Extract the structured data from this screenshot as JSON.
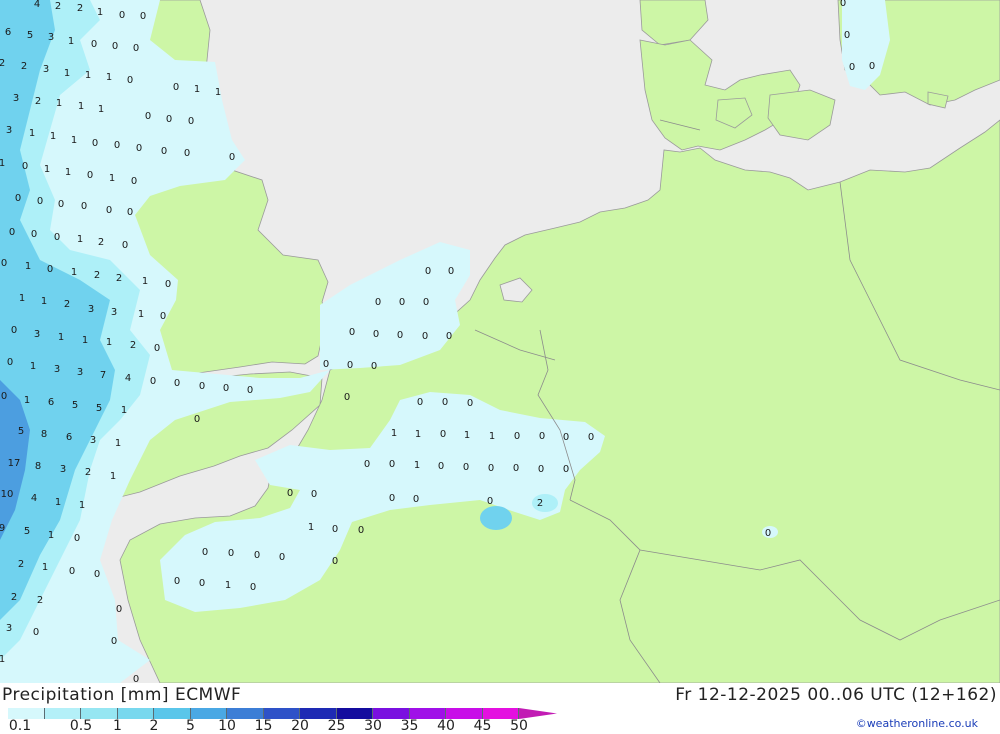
{
  "header": {
    "title": "Precipitation [mm] ECMWF",
    "valid_time": "Fr 12-12-2025 00..06 UTC (12+162)",
    "credit": "©weatheronline.co.uk"
  },
  "legend": {
    "levels": [
      "0.1",
      "0.5",
      "1",
      "2",
      "5",
      "10",
      "15",
      "20",
      "25",
      "30",
      "35",
      "40",
      "45",
      "50"
    ],
    "colors": [
      "#d6f8fc",
      "#b4f0f8",
      "#96e6f2",
      "#78d8ee",
      "#5ac6ea",
      "#4aa8e4",
      "#3c7ed6",
      "#2e52c8",
      "#1e2ab4",
      "#140c9e",
      "#7a10e0",
      "#a010e8",
      "#c80ee8",
      "#e410e0",
      "#c21cb4"
    ]
  },
  "map": {
    "colors": {
      "sea": "#ececec",
      "land": "#cdf6a6",
      "rain_light": "#d6f8fc",
      "rain_mid": "#aef0f8",
      "rain_heavy": "#70d2ee",
      "rain_max": "#4c9ee0",
      "border": "#8c8c8c"
    },
    "values": [
      [
        "4",
        37,
        4
      ],
      [
        "2",
        58,
        6
      ],
      [
        "2",
        80,
        8
      ],
      [
        "1",
        100,
        12
      ],
      [
        "0",
        122,
        15
      ],
      [
        "0",
        143,
        16
      ],
      [
        "6",
        8,
        32
      ],
      [
        "5",
        30,
        35
      ],
      [
        "3",
        51,
        37
      ],
      [
        "1",
        71,
        41
      ],
      [
        "0",
        94,
        44
      ],
      [
        "0",
        115,
        46
      ],
      [
        "0",
        136,
        48
      ],
      [
        "2",
        2,
        63
      ],
      [
        "2",
        24,
        66
      ],
      [
        "3",
        46,
        69
      ],
      [
        "1",
        67,
        73
      ],
      [
        "1",
        88,
        75
      ],
      [
        "1",
        109,
        77
      ],
      [
        "0",
        130,
        80
      ],
      [
        "0",
        176,
        87
      ],
      [
        "1",
        197,
        89
      ],
      [
        "1",
        218,
        92
      ],
      [
        "3",
        16,
        98
      ],
      [
        "2",
        38,
        101
      ],
      [
        "1",
        59,
        103
      ],
      [
        "1",
        81,
        106
      ],
      [
        "1",
        101,
        109
      ],
      [
        "0",
        148,
        116
      ],
      [
        "0",
        169,
        119
      ],
      [
        "0",
        191,
        121
      ],
      [
        "3",
        9,
        130
      ],
      [
        "1",
        32,
        133
      ],
      [
        "1",
        53,
        136
      ],
      [
        "1",
        74,
        140
      ],
      [
        "0",
        95,
        143
      ],
      [
        "0",
        117,
        145
      ],
      [
        "0",
        139,
        148
      ],
      [
        "0",
        164,
        151
      ],
      [
        "0",
        187,
        153
      ],
      [
        "0",
        232,
        157
      ],
      [
        "1",
        2,
        163
      ],
      [
        "0",
        25,
        166
      ],
      [
        "1",
        47,
        169
      ],
      [
        "1",
        68,
        172
      ],
      [
        "0",
        90,
        175
      ],
      [
        "1",
        112,
        178
      ],
      [
        "0",
        134,
        181
      ],
      [
        "0",
        18,
        198
      ],
      [
        "0",
        40,
        201
      ],
      [
        "0",
        61,
        204
      ],
      [
        "0",
        84,
        206
      ],
      [
        "0",
        109,
        210
      ],
      [
        "0",
        130,
        212
      ],
      [
        "0",
        12,
        232
      ],
      [
        "0",
        34,
        234
      ],
      [
        "0",
        57,
        237
      ],
      [
        "1",
        80,
        239
      ],
      [
        "2",
        101,
        242
      ],
      [
        "0",
        125,
        245
      ],
      [
        "0",
        4,
        263
      ],
      [
        "1",
        28,
        266
      ],
      [
        "0",
        50,
        269
      ],
      [
        "1",
        74,
        272
      ],
      [
        "2",
        97,
        275
      ],
      [
        "2",
        119,
        278
      ],
      [
        "1",
        145,
        281
      ],
      [
        "0",
        168,
        284
      ],
      [
        "1",
        22,
        298
      ],
      [
        "1",
        44,
        301
      ],
      [
        "2",
        67,
        304
      ],
      [
        "3",
        91,
        309
      ],
      [
        "3",
        114,
        312
      ],
      [
        "1",
        141,
        314
      ],
      [
        "0",
        163,
        316
      ],
      [
        "0",
        14,
        330
      ],
      [
        "3",
        37,
        334
      ],
      [
        "1",
        61,
        337
      ],
      [
        "1",
        85,
        340
      ],
      [
        "1",
        109,
        342
      ],
      [
        "2",
        133,
        345
      ],
      [
        "0",
        157,
        348
      ],
      [
        "0",
        10,
        362
      ],
      [
        "1",
        33,
        366
      ],
      [
        "3",
        57,
        369
      ],
      [
        "3",
        80,
        372
      ],
      [
        "7",
        103,
        375
      ],
      [
        "4",
        128,
        378
      ],
      [
        "0",
        153,
        381
      ],
      [
        "0",
        177,
        383
      ],
      [
        "0",
        202,
        386
      ],
      [
        "0",
        226,
        388
      ],
      [
        "0",
        250,
        390
      ],
      [
        "0",
        4,
        396
      ],
      [
        "1",
        27,
        400
      ],
      [
        "6",
        51,
        402
      ],
      [
        "5",
        75,
        405
      ],
      [
        "5",
        99,
        408
      ],
      [
        "1",
        124,
        410
      ],
      [
        "5",
        21,
        431
      ],
      [
        "8",
        44,
        434
      ],
      [
        "6",
        69,
        437
      ],
      [
        "3",
        93,
        440
      ],
      [
        "1",
        118,
        443
      ],
      [
        "17",
        14,
        463
      ],
      [
        "8",
        38,
        466
      ],
      [
        "3",
        63,
        469
      ],
      [
        "2",
        88,
        472
      ],
      [
        "1",
        113,
        476
      ],
      [
        "10",
        7,
        494
      ],
      [
        "4",
        34,
        498
      ],
      [
        "1",
        58,
        502
      ],
      [
        "1",
        82,
        505
      ],
      [
        "9",
        2,
        528
      ],
      [
        "5",
        27,
        531
      ],
      [
        "1",
        51,
        535
      ],
      [
        "0",
        77,
        538
      ],
      [
        "2",
        21,
        564
      ],
      [
        "1",
        45,
        567
      ],
      [
        "0",
        72,
        571
      ],
      [
        "0",
        97,
        574
      ],
      [
        "2",
        14,
        597
      ],
      [
        "2",
        40,
        600
      ],
      [
        "0",
        119,
        609
      ],
      [
        "3",
        9,
        628
      ],
      [
        "0",
        36,
        632
      ],
      [
        "0",
        114,
        641
      ],
      [
        "1",
        2,
        659
      ],
      [
        "0",
        136,
        679
      ],
      [
        "0",
        428,
        271
      ],
      [
        "0",
        451,
        271
      ],
      [
        "0",
        378,
        302
      ],
      [
        "0",
        402,
        302
      ],
      [
        "0",
        426,
        302
      ],
      [
        "0",
        352,
        332
      ],
      [
        "0",
        376,
        334
      ],
      [
        "0",
        400,
        335
      ],
      [
        "0",
        425,
        336
      ],
      [
        "0",
        449,
        336
      ],
      [
        "0",
        326,
        364
      ],
      [
        "0",
        350,
        365
      ],
      [
        "0",
        374,
        366
      ],
      [
        "0",
        347,
        397
      ],
      [
        "0",
        197,
        419
      ],
      [
        "0",
        420,
        402
      ],
      [
        "0",
        445,
        402
      ],
      [
        "0",
        470,
        403
      ],
      [
        "1",
        394,
        433
      ],
      [
        "1",
        418,
        434
      ],
      [
        "0",
        443,
        434
      ],
      [
        "1",
        467,
        435
      ],
      [
        "1",
        492,
        436
      ],
      [
        "0",
        517,
        436
      ],
      [
        "0",
        542,
        436
      ],
      [
        "0",
        566,
        437
      ],
      [
        "0",
        591,
        437
      ],
      [
        "0",
        367,
        464
      ],
      [
        "0",
        392,
        464
      ],
      [
        "1",
        417,
        465
      ],
      [
        "0",
        441,
        466
      ],
      [
        "0",
        466,
        467
      ],
      [
        "0",
        491,
        468
      ],
      [
        "0",
        516,
        468
      ],
      [
        "0",
        541,
        469
      ],
      [
        "0",
        566,
        469
      ],
      [
        "0",
        290,
        493
      ],
      [
        "0",
        314,
        494
      ],
      [
        "0",
        392,
        498
      ],
      [
        "0",
        416,
        499
      ],
      [
        "0",
        490,
        501
      ],
      [
        "2",
        540,
        503
      ],
      [
        "1",
        311,
        527
      ],
      [
        "0",
        335,
        529
      ],
      [
        "0",
        361,
        530
      ],
      [
        "0",
        768,
        533
      ],
      [
        "0",
        205,
        552
      ],
      [
        "0",
        231,
        553
      ],
      [
        "0",
        257,
        555
      ],
      [
        "0",
        282,
        557
      ],
      [
        "0",
        335,
        561
      ],
      [
        "0",
        177,
        581
      ],
      [
        "0",
        202,
        583
      ],
      [
        "1",
        228,
        585
      ],
      [
        "0",
        253,
        587
      ],
      [
        "0",
        843,
        3
      ],
      [
        "0",
        847,
        35
      ],
      [
        "0",
        852,
        67
      ],
      [
        "0",
        872,
        66
      ]
    ]
  }
}
